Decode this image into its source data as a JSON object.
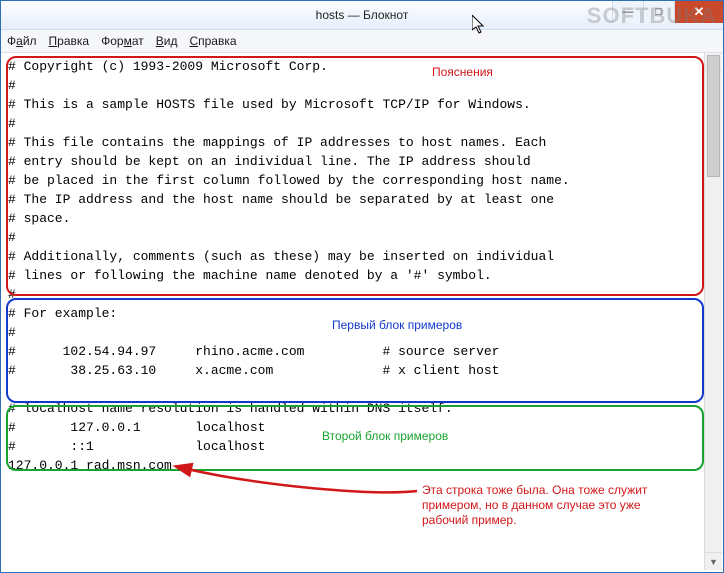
{
  "window": {
    "title": "hosts — Блокнот",
    "minimize": "—",
    "maximize": "□",
    "close": "✕"
  },
  "menu": {
    "file": {
      "pre": "Ф",
      "hot": "а",
      "post": "йл"
    },
    "edit": {
      "pre": "",
      "hot": "П",
      "post": "равка"
    },
    "format": {
      "pre": "Фор",
      "hot": "м",
      "post": "ат"
    },
    "view": {
      "pre": "",
      "hot": "В",
      "post": "ид"
    },
    "help": {
      "pre": "",
      "hot": "С",
      "post": "правка"
    }
  },
  "content": {
    "body": "# Copyright (c) 1993-2009 Microsoft Corp.\n#\n# This is a sample HOSTS file used by Microsoft TCP/IP for Windows.\n#\n# This file contains the mappings of IP addresses to host names. Each\n# entry should be kept on an individual line. The IP address should\n# be placed in the first column followed by the corresponding host name.\n# The IP address and the host name should be separated by at least one\n# space.\n#\n# Additionally, comments (such as these) may be inserted on individual\n# lines or following the machine name denoted by a '#' symbol.\n#\n# For example:\n#\n#      102.54.94.97     rhino.acme.com          # source server\n#       38.25.63.10     x.acme.com              # x client host\n\n# localhost name resolution is handled within DNS itself.\n#       127.0.0.1       localhost\n#       ::1             localhost\n127.0.0.1 rad.msn.com"
  },
  "annotations": {
    "desc": "Пояснения",
    "first": "Первый блок примеров",
    "second": "Второй блок примеров",
    "note": "Эта строка тоже была. Она тоже служит\nпримером, но в данном случае это уже\nрабочий пример."
  },
  "watermark": "SOFTBUKA"
}
